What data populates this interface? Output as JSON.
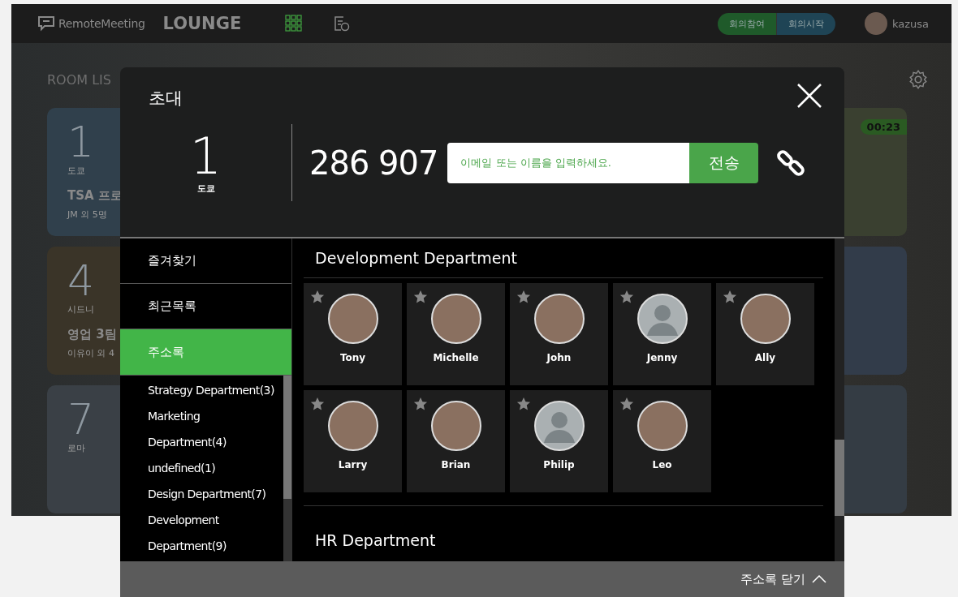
{
  "topbar": {
    "brand": "RemoteMeeting",
    "section": "LOUNGE",
    "nav_icons": [
      {
        "kind": "grid",
        "selected": true
      },
      {
        "kind": "history",
        "selected": false
      }
    ],
    "meeting_buttons": [
      {
        "label": "회의참여",
        "kind": "join"
      },
      {
        "label": "회의시작",
        "kind": "start"
      }
    ],
    "user": {
      "name": "kazusa"
    }
  },
  "room_list": {
    "title": "ROOM LIS",
    "cards": [
      {
        "kind": "tower",
        "number": "1",
        "city": "도쿄",
        "title": "TSA 프로",
        "participants": "JM 외 5명"
      },
      {
        "kind": "palms",
        "timer": "00:23"
      },
      {
        "kind": "opera",
        "number": "4",
        "city": "시드니",
        "title": "영업 3팀",
        "participants": "이유이 외 4"
      },
      {
        "kind": "domes"
      },
      {
        "kind": "arena",
        "number": "7",
        "city": "로마"
      },
      {
        "kind": "clocktower"
      }
    ]
  },
  "invite_dialog": {
    "title": "초대",
    "room": {
      "number": "1",
      "city": "도쿄"
    },
    "code": "286 907",
    "invite_field": {
      "placeholder": "이메일 또는 이름을 입력하세요."
    },
    "send_button": "전송",
    "menu": [
      {
        "label": "즐겨찾기",
        "selected": false
      },
      {
        "label": "최근목록",
        "selected": false
      },
      {
        "label": "주소록",
        "selected": true
      }
    ],
    "groups": [
      "Strategy Department(3)",
      "Marketing Department(4)",
      "undefined(1)",
      "Design Department(7)",
      "Development Department(9)"
    ],
    "sections": [
      {
        "title": "Development Department",
        "contacts": [
          {
            "name": "Tony",
            "kind": "photo",
            "favorite": false
          },
          {
            "name": "Michelle",
            "kind": "photo",
            "favorite": false
          },
          {
            "name": "John",
            "kind": "photo",
            "favorite": false
          },
          {
            "name": "Jenny",
            "kind": "default",
            "favorite": false
          },
          {
            "name": "Ally",
            "kind": "photo",
            "favorite": false
          },
          {
            "name": "Larry",
            "kind": "photo",
            "favorite": false
          },
          {
            "name": "Brian",
            "kind": "photo",
            "favorite": false
          },
          {
            "name": "Philip",
            "kind": "default",
            "favorite": false
          },
          {
            "name": "Leo",
            "kind": "photo",
            "favorite": false
          }
        ]
      },
      {
        "title": "HR Department"
      }
    ],
    "close_button": "주소록 닫기"
  }
}
